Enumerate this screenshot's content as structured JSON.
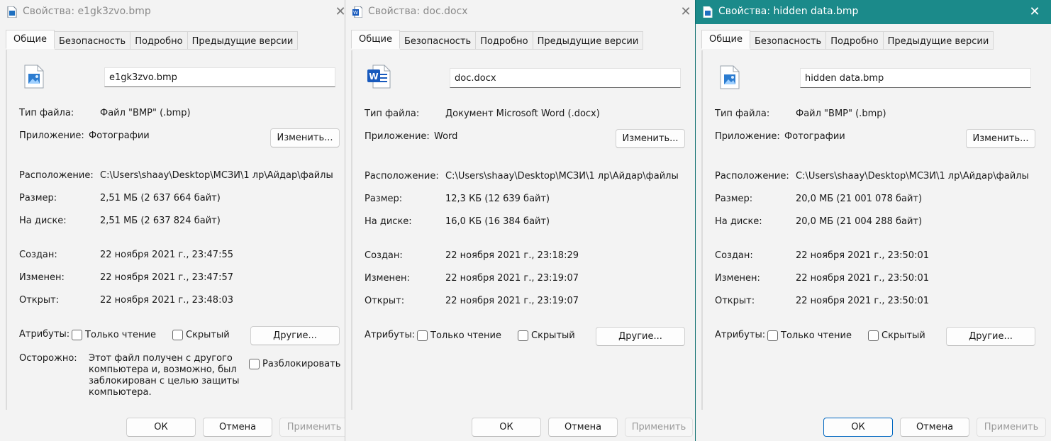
{
  "windows": [
    {
      "title": "Свойства: e1gk3zvo.bmp",
      "file_icon": "image-file-icon",
      "tabs": [
        "Общие",
        "Безопасность",
        "Подробно",
        "Предыдущие версии"
      ],
      "file_name": "e1gk3zvo.bmp",
      "labels": {
        "file_type": "Тип файла:",
        "application": "Приложение:",
        "location": "Расположение:",
        "size": "Размер:",
        "on_disk": "На диске:",
        "created": "Создан:",
        "modified": "Изменен:",
        "accessed": "Открыт:",
        "attributes": "Атрибуты:",
        "warning": "Осторожно:"
      },
      "file_type": "Файл \"BMP\" (.bmp)",
      "application": "Фотографии",
      "change_button": "Изменить...",
      "location": "C:\\Users\\shaay\\Desktop\\МСЗИ\\1 лр\\Айдар\\файлы",
      "size": "2,51 МБ (2 637 664 байт)",
      "on_disk": "2,51 МБ (2 637 824 байт)",
      "created": "22 ноября 2021 г., 23:47:55",
      "modified": "22 ноября 2021 г., 23:47:57",
      "accessed": "22 ноября 2021 г., 23:48:03",
      "readonly_label": "Только чтение",
      "hidden_label": "Скрытый",
      "other_button": "Другие...",
      "warning_text": "Этот файл получен с другого компьютера и, возможно, был заблокирован с целью защиты компьютера.",
      "unblock_label": "Разблокировать",
      "ok_button": "ОК",
      "cancel_button": "Отмена",
      "apply_button": "Применить"
    },
    {
      "title": "Свойства: doc.docx",
      "file_icon": "word-document-icon",
      "tabs": [
        "Общие",
        "Безопасность",
        "Подробно",
        "Предыдущие версии"
      ],
      "file_name": "doc.docx",
      "labels": {
        "file_type": "Тип файла:",
        "application": "Приложение:",
        "location": "Расположение:",
        "size": "Размер:",
        "on_disk": "На диске:",
        "created": "Создан:",
        "modified": "Изменен:",
        "accessed": "Открыт:",
        "attributes": "Атрибуты:"
      },
      "file_type": "Документ Microsoft Word (.docx)",
      "application": "Word",
      "change_button": "Изменить...",
      "location": "C:\\Users\\shaay\\Desktop\\МСЗИ\\1 лр\\Айдар\\файлы",
      "size": "12,3 КБ (12 639 байт)",
      "on_disk": "16,0 КБ (16 384 байт)",
      "created": "22 ноября 2021 г., 23:18:29",
      "modified": "22 ноября 2021 г., 23:19:07",
      "accessed": "22 ноября 2021 г., 23:19:07",
      "readonly_label": "Только чтение",
      "hidden_label": "Скрытый",
      "other_button": "Другие...",
      "ok_button": "ОК",
      "cancel_button": "Отмена",
      "apply_button": "Применить"
    },
    {
      "title": "Свойства: hidden data.bmp",
      "file_icon": "image-file-icon",
      "tabs": [
        "Общие",
        "Безопасность",
        "Подробно",
        "Предыдущие версии"
      ],
      "file_name": "hidden data.bmp",
      "labels": {
        "file_type": "Тип файла:",
        "application": "Приложение:",
        "location": "Расположение:",
        "size": "Размер:",
        "on_disk": "На диске:",
        "created": "Создан:",
        "modified": "Изменен:",
        "accessed": "Открыт:",
        "attributes": "Атрибуты:"
      },
      "file_type": "Файл \"BMP\" (.bmp)",
      "application": "Фотографии",
      "change_button": "Изменить...",
      "location": "C:\\Users\\shaay\\Desktop\\МСЗИ\\1 лр\\Айдар\\файлы",
      "size": "20,0 МБ (21 001 078 байт)",
      "on_disk": "20,0 МБ (21 004 288 байт)",
      "created": "22 ноября 2021 г., 23:50:01",
      "modified": "22 ноября 2021 г., 23:50:01",
      "accessed": "22 ноября 2021 г., 23:50:01",
      "readonly_label": "Только чтение",
      "hidden_label": "Скрытый",
      "other_button": "Другие...",
      "ok_button": "ОК",
      "cancel_button": "Отмена",
      "apply_button": "Применить"
    }
  ],
  "colors": {
    "active_titlebar": "#1b8a8a",
    "window_bg": "#f3f3f3",
    "panel_bg": "#fcfcfc",
    "default_button_border": "#0067c0"
  }
}
